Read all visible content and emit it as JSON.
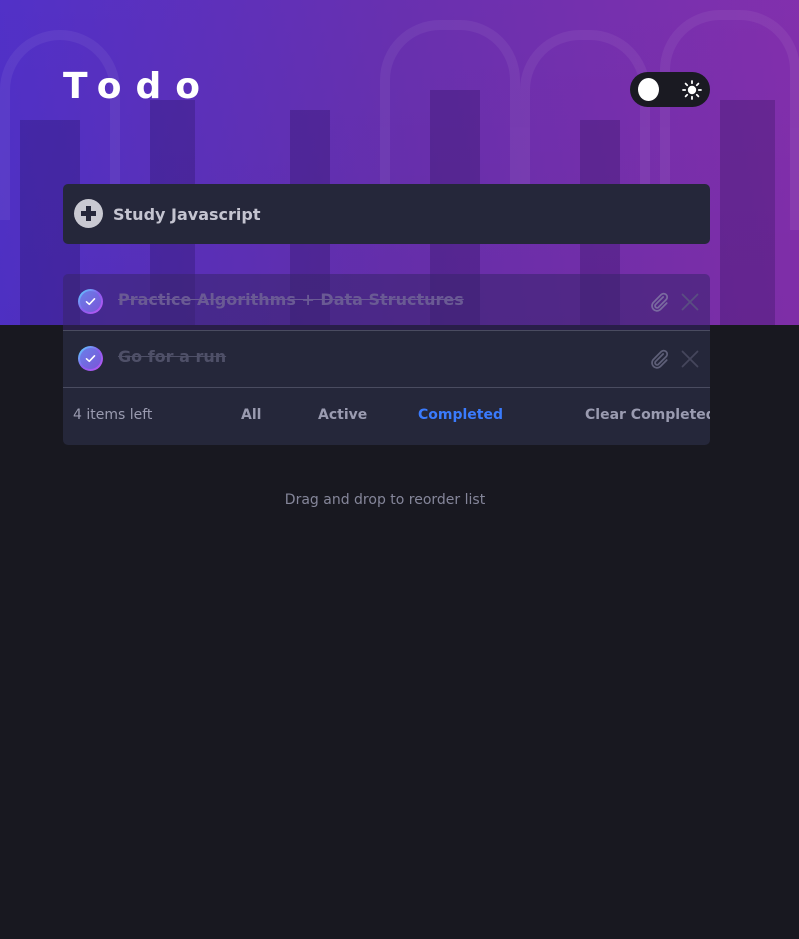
{
  "app": {
    "title": "Todo"
  },
  "theme": {
    "toggle_state": "dark",
    "accent": "#3a7bfd",
    "background": "#181820",
    "card": "#25273a",
    "gradient_start": "#57ddff",
    "gradient_end": "#c058f3",
    "toggle_icon": "sun-icon"
  },
  "new_todo": {
    "icon": "add-icon",
    "value": "Study Javascript"
  },
  "todos": [
    {
      "text": "Practice Algorithms + Data Structures",
      "completed": true,
      "icons": [
        "check-icon",
        "attach-icon",
        "delete-icon"
      ]
    },
    {
      "text": "Go for a run",
      "completed": true,
      "icons": [
        "check-icon",
        "attach-icon",
        "delete-icon"
      ]
    }
  ],
  "footer": {
    "items_left": "4 items left",
    "filters": {
      "all": "All",
      "active": "Active",
      "completed": "Completed"
    },
    "selected_filter": "Completed",
    "clear_completed": "Clear Completed"
  },
  "hint": "Drag and drop to reorder list"
}
